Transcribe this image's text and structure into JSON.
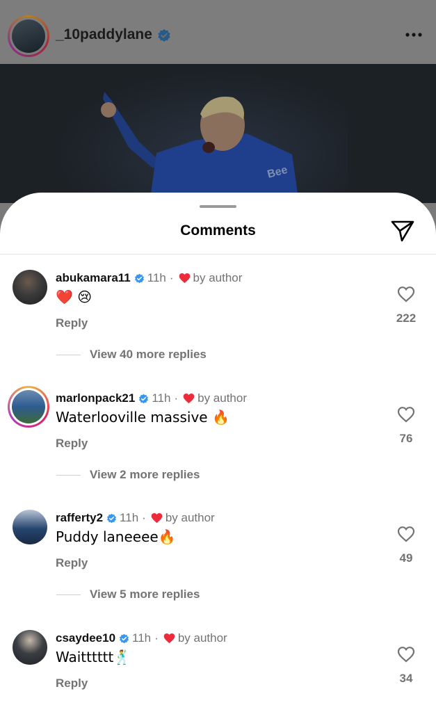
{
  "post": {
    "username": "_10paddylane"
  },
  "sheet": {
    "title": "Comments"
  },
  "comments": [
    {
      "username": "abukamara11",
      "time": "11h",
      "separator": "·",
      "liked_label": "by author",
      "text": "❤️ 😢",
      "reply_label": "Reply",
      "likes": "222",
      "view_replies": "View 40 more replies",
      "avatar_color": "#3a3a3a"
    },
    {
      "username": "marlonpack21",
      "time": "11h",
      "separator": "·",
      "liked_label": "by author",
      "text": "Waterlooville massive 🔥",
      "reply_label": "Reply",
      "likes": "76",
      "view_replies": "View 2 more replies",
      "avatar_color": "#2e5b8f"
    },
    {
      "username": "rafferty2",
      "time": "11h",
      "separator": "·",
      "liked_label": "by author",
      "text": "Puddy laneeee🔥",
      "reply_label": "Reply",
      "likes": "49",
      "view_replies": "View 5 more replies",
      "avatar_color": "#26456e"
    },
    {
      "username": "csaydee10",
      "time": "11h",
      "separator": "·",
      "liked_label": "by author",
      "text": "Waitttttt🕺",
      "reply_label": "Reply",
      "likes": "34",
      "avatar_color": "#3b3f44"
    }
  ],
  "colors": {
    "verified_blue": "#3797f0",
    "heart_red": "#ed2b3b",
    "meta_grey": "#737373"
  },
  "icons": {
    "more": "more-horizontal-icon",
    "share": "paper-plane-icon",
    "like": "heart-outline-icon",
    "verified": "verified-badge-icon",
    "liked_by_author": "red-heart-icon"
  }
}
